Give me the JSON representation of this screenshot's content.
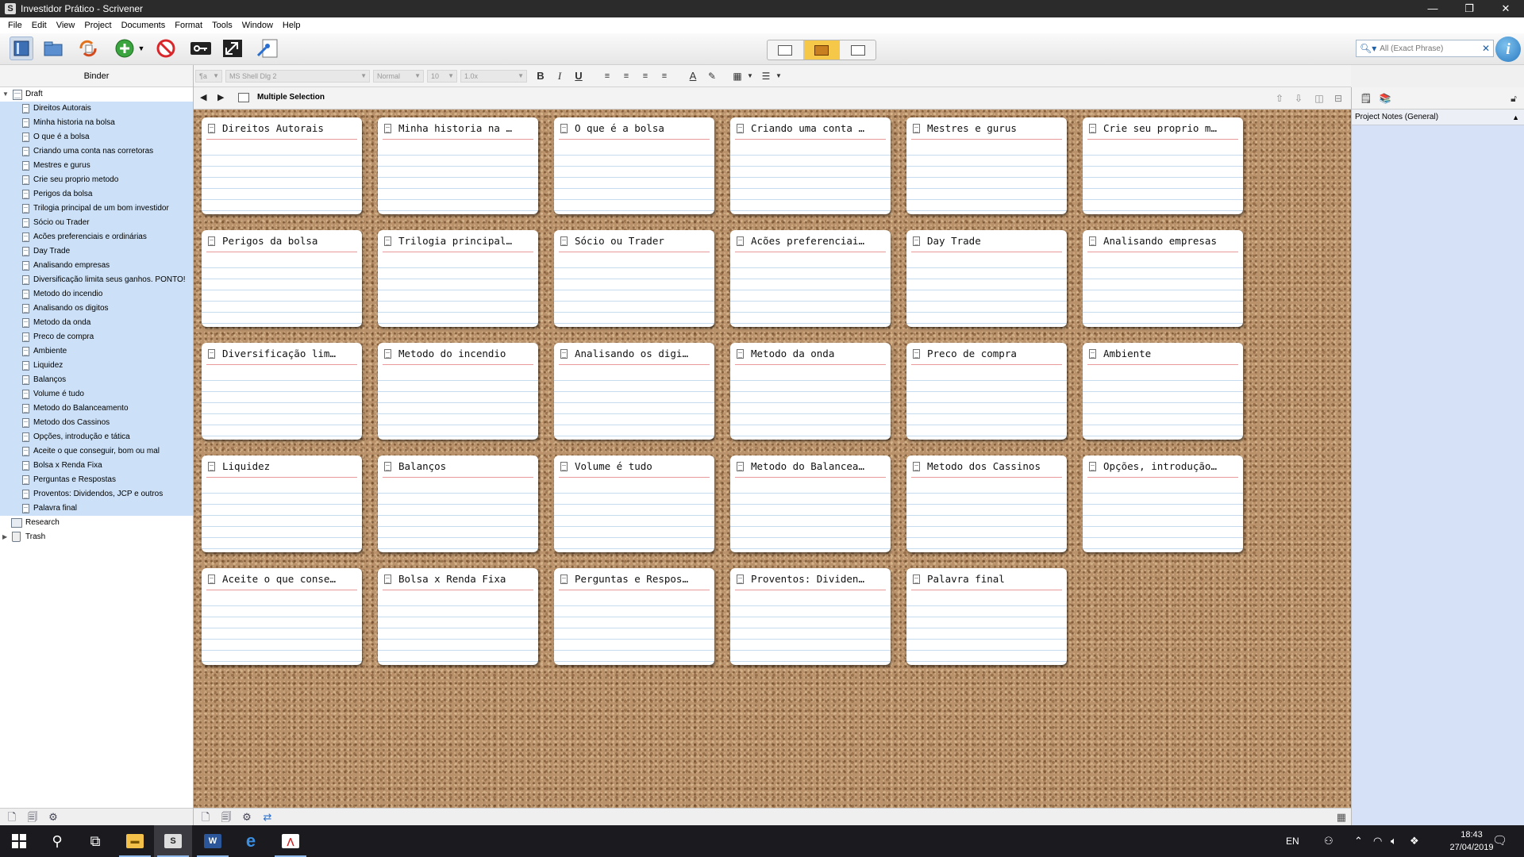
{
  "window": {
    "title": "Investidor Prático - Scrivener",
    "minimize": "—",
    "restore": "❐",
    "close": "✕"
  },
  "menu": [
    "File",
    "Edit",
    "View",
    "Project",
    "Documents",
    "Format",
    "Tools",
    "Window",
    "Help"
  ],
  "search": {
    "placeholder": "All (Exact Phrase)"
  },
  "binder": {
    "header": "Binder",
    "draft": "Draft",
    "items": [
      "Direitos Autorais",
      "Minha historia na bolsa",
      "O que é a bolsa",
      "Criando uma conta nas corretoras",
      "Mestres e gurus",
      "Crie seu proprio metodo",
      "Perigos da bolsa",
      "Trilogia principal de um bom investidor",
      "Sócio ou Trader",
      "Acões preferenciais e ordinárias",
      "Day Trade",
      "Analisando empresas",
      "Diversificação limita seus ganhos. PONTO!",
      "Metodo do incendio",
      "Analisando os digitos",
      "Metodo da onda",
      "Preco de compra",
      "Ambiente",
      "Liquidez",
      "Balanços",
      "Volume é tudo",
      "Metodo do Balanceamento",
      "Metodo dos Cassinos",
      "Opções, introdução e tática",
      "Aceite o que conseguir, bom ou mal",
      "Bolsa x Renda Fixa",
      "Perguntas e Respostas",
      "Proventos: Dividendos, JCP e outros",
      "Palavra final"
    ],
    "research": "Research",
    "trash": "Trash"
  },
  "formatbar": {
    "style": "¶a",
    "font": "MS Shell Dlg 2",
    "weight": "Normal",
    "size": "10",
    "spacing": "1.0x",
    "bold": "B",
    "italic": "I",
    "underline": "U"
  },
  "editor": {
    "title": "Multiple Selection",
    "back": "◀",
    "forward": "▶"
  },
  "cards": [
    "Direitos Autorais",
    "Minha historia na …",
    "O que é a bolsa",
    "Criando uma conta …",
    "Mestres e gurus",
    "Crie seu proprio m…",
    "Perigos da bolsa",
    "Trilogia principal…",
    "Sócio ou Trader",
    "Acões preferenciai…",
    "Day Trade",
    "Analisando empresas",
    "Diversificação lim…",
    "Metodo do incendio",
    "Analisando os digi…",
    "Metodo da onda",
    "Preco de compra",
    "Ambiente",
    "Liquidez",
    "Balanços",
    "Volume é tudo",
    "Metodo do Balancea…",
    "Metodo dos Cassinos",
    "Opções, introdução…",
    "Aceite o que conse…",
    "Bolsa x Renda Fixa",
    "Perguntas e Respos…",
    "Proventos: Dividen…",
    "Palavra final"
  ],
  "inspector": {
    "notes_title": "Project Notes (General)"
  },
  "taskbar": {
    "language": "EN",
    "time": "18:43",
    "date": "27/04/2019"
  }
}
